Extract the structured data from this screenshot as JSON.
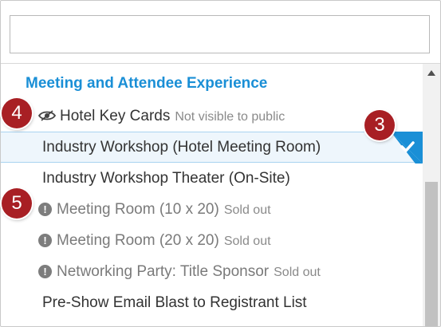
{
  "search": {
    "value": "",
    "placeholder": ""
  },
  "group": {
    "title": "Meeting and Attendee Experience"
  },
  "items": [
    {
      "label": "Hotel Key Cards",
      "status": "Not visible to public",
      "icon": "eye-slash-icon"
    },
    {
      "label": "Industry Workshop (Hotel Meeting Room)",
      "status": "",
      "selected": true,
      "icon": "checkmark-icon"
    },
    {
      "label": "Industry Workshop Theater (On-Site)",
      "status": ""
    },
    {
      "label": "Meeting Room (10 x 20)",
      "status": "Sold out",
      "icon": "alert-icon"
    },
    {
      "label": "Meeting Room (20 x 20)",
      "status": "Sold out",
      "icon": "alert-icon"
    },
    {
      "label": "Networking Party: Title Sponsor",
      "status": "Sold out",
      "icon": "alert-icon"
    },
    {
      "label": "Pre-Show Email Blast to Registrant List",
      "status": ""
    }
  ],
  "alert_glyph": "!",
  "markers": [
    "4",
    "3",
    "5"
  ],
  "colors": {
    "accent": "#1a8fd6",
    "marker": "#a81f24",
    "selected_bg": "#eef6fc"
  }
}
